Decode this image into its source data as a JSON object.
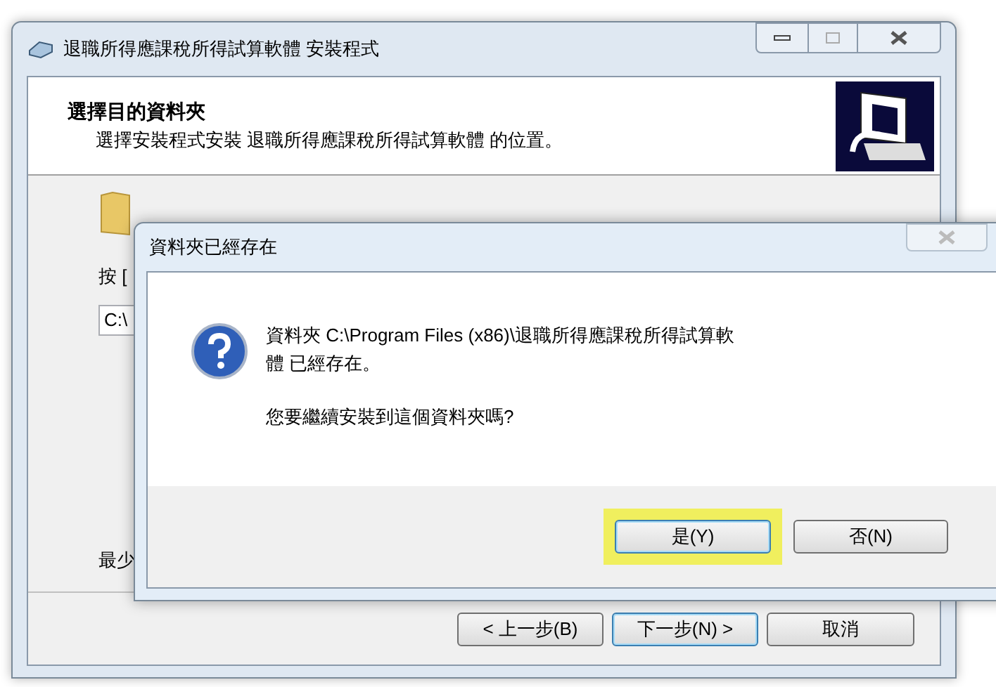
{
  "window": {
    "title": "退職所得應課稅所得試算軟體 安裝程式"
  },
  "header": {
    "title": "選擇目的資料夾",
    "subtitle": "選擇安裝程式安裝 退職所得應課稅所得試算軟體 的位置。"
  },
  "body": {
    "instruction": "按 [",
    "path_field": {
      "value": "C:\\"
    },
    "space_label": "最少"
  },
  "buttons": [
    {
      "label": "< 上一步(B)",
      "default": false
    },
    {
      "label": "下一步(N) >",
      "default": true
    },
    {
      "label": "取消",
      "default": false
    }
  ],
  "dialog": {
    "title": "資料夾已經存在",
    "message": "資料夾 C:\\Program Files (x86)\\退職所得應課稅所得試算軟體 已經存在。",
    "question": "您要繼續安裝到這個資料夾嗎?",
    "buttons": [
      {
        "label": "是(Y)",
        "default": true,
        "highlighted": true
      },
      {
        "label": "否(N)",
        "default": false,
        "highlighted": false
      }
    ]
  }
}
